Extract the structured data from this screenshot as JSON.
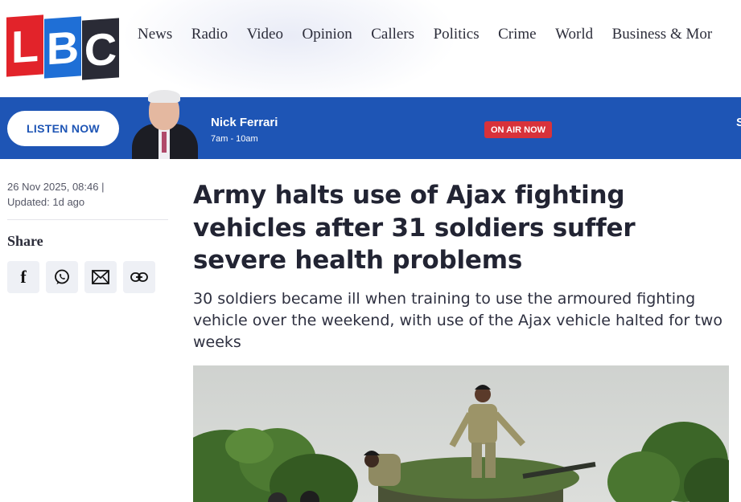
{
  "brand": {
    "logo_letters": [
      "L",
      "B",
      "C"
    ],
    "colors": {
      "red": "#e2232a",
      "blue": "#1f6fd6",
      "dark": "#2a2b36"
    }
  },
  "nav": {
    "items": [
      "News",
      "Radio",
      "Video",
      "Opinion",
      "Callers",
      "Politics",
      "Crime",
      "World",
      "Business & Mor"
    ]
  },
  "listen_bar": {
    "background": "#1e55b5",
    "listen_label": "LISTEN NOW",
    "presenter": "Nick Ferrari",
    "time": "7am - 10am",
    "on_air": "ON AIR NOW",
    "edge_text": "S"
  },
  "article": {
    "date": "26 Nov 2025, 08:46 |",
    "updated": "Updated: 1d ago",
    "headline": "Army halts use of Ajax fighting vehicles after 31 soldiers suffer severe health problems",
    "standfirst": "30 soldiers became ill when training to use the armoured fighting vehicle over the weekend, with use of the Ajax vehicle halted for two weeks"
  },
  "share": {
    "title": "Share",
    "buttons": [
      {
        "icon": "facebook-icon"
      },
      {
        "icon": "whatsapp-icon"
      },
      {
        "icon": "email-icon"
      },
      {
        "icon": "link-icon"
      }
    ]
  }
}
